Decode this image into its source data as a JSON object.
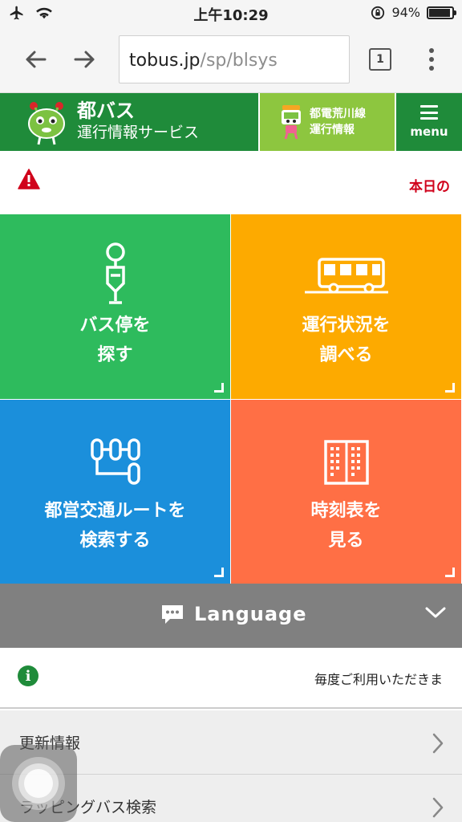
{
  "status_bar": {
    "time": "上午10:29",
    "battery": "94%",
    "battery_level": 0.94
  },
  "browser": {
    "url_host": "tobus.jp",
    "url_path": "/sp/blsys",
    "tab_count": "1"
  },
  "header": {
    "title_line1": "都バス",
    "title_line2": "運行情報サービス",
    "toden_line1": "都電荒川線",
    "toden_line2": "運行情報",
    "menu_label": "menu"
  },
  "alert": {
    "text": "本日の"
  },
  "tiles": [
    {
      "line1": "バス停を",
      "line2": "探す",
      "color": "#2ebb5d",
      "icon": "bus-stop-icon"
    },
    {
      "line1": "運行状況を",
      "line2": "調べる",
      "color": "#fdaa00",
      "icon": "bus-icon"
    },
    {
      "line1": "都営交通ルートを",
      "line2": "検索する",
      "color": "#1b8fdb",
      "icon": "route-icon"
    },
    {
      "line1": "時刻表を",
      "line2": "見る",
      "color": "#ff6f45",
      "icon": "timetable-icon"
    }
  ],
  "language": {
    "label": "Language"
  },
  "info": {
    "text": "毎度ご利用いただきま"
  },
  "list": [
    {
      "label": "更新情報"
    },
    {
      "label": "ラッピングバス検索"
    }
  ]
}
